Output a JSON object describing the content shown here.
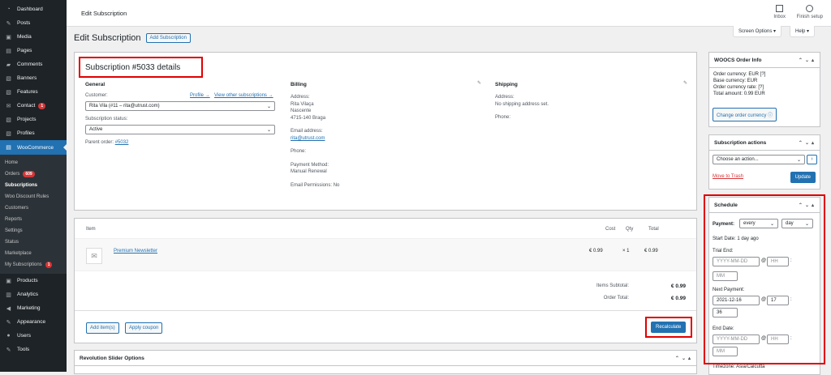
{
  "sidebar": {
    "items": [
      {
        "name": "dashboard",
        "label": "Dashboard",
        "icon": "◔"
      },
      {
        "name": "posts",
        "label": "Posts",
        "icon": "✎"
      },
      {
        "name": "media",
        "label": "Media",
        "icon": "▣"
      },
      {
        "name": "pages",
        "label": "Pages",
        "icon": "▤"
      },
      {
        "name": "comments",
        "label": "Comments",
        "icon": "▰"
      },
      {
        "name": "banners",
        "label": "Banners",
        "icon": "▧"
      },
      {
        "name": "features",
        "label": "Features",
        "icon": "▧"
      },
      {
        "name": "contact",
        "label": "Contact",
        "icon": "✉",
        "badge": "1"
      },
      {
        "name": "projects",
        "label": "Projects",
        "icon": "▧"
      },
      {
        "name": "profiles",
        "label": "Profiles",
        "icon": "▧"
      }
    ],
    "woo": {
      "label": "WooCommerce",
      "icon": "▤"
    },
    "sub": [
      {
        "label": "Home"
      },
      {
        "label": "Orders",
        "badge": "609"
      },
      {
        "label": "Subscriptions",
        "current": true
      },
      {
        "label": "Woo Discount Rules"
      },
      {
        "label": "Customers"
      },
      {
        "label": "Reports"
      },
      {
        "label": "Settings"
      },
      {
        "label": "Status"
      },
      {
        "label": "Marketplace"
      },
      {
        "label": "My Subscriptions",
        "badge": "1"
      }
    ],
    "items2": [
      {
        "name": "products",
        "label": "Products",
        "icon": "▣"
      },
      {
        "name": "analytics",
        "label": "Analytics",
        "icon": "▥"
      },
      {
        "name": "marketing",
        "label": "Marketing",
        "icon": "◀"
      },
      {
        "name": "appearance",
        "label": "Appearance",
        "icon": "✎"
      },
      {
        "name": "users",
        "label": "Users",
        "icon": "●"
      },
      {
        "name": "tools",
        "label": "Tools",
        "icon": "✎"
      }
    ]
  },
  "topbar": {
    "title": "Edit Subscription",
    "inbox": "Inbox",
    "finish": "Finish setup",
    "screen_options": "Screen Options ▾",
    "help": "Help ▾"
  },
  "head": {
    "title": "Edit Subscription",
    "add": "Add Subscription"
  },
  "details": {
    "title": "Subscription #5033 details",
    "general": {
      "heading": "General",
      "customer_label": "Customer:",
      "profile_link": "Profile →",
      "other_link": "View other subscriptions →",
      "customer_value": "Rita Vila (#11 – rita@utrust.com)",
      "status_label": "Subscription status:",
      "status_value": "Active",
      "parent_label": "Parent order:",
      "parent_link": "#5032"
    },
    "billing": {
      "heading": "Billing",
      "address_label": "Address:",
      "address_lines": [
        "Rita Vilaça",
        "Nascente",
        "4715-140 Braga"
      ],
      "email_label": "Email address:",
      "email": "rita@utrust.com",
      "phone_label": "Phone:",
      "payment_label": "Payment Method:",
      "payment_value": "Manual Renewal",
      "perm_label": "Email Permissions:",
      "perm_value": "No"
    },
    "shipping": {
      "heading": "Shipping",
      "address_label": "Address:",
      "address_value": "No shipping address set.",
      "phone_label": "Phone:"
    }
  },
  "items": {
    "col_item": "Item",
    "col_cost": "Cost",
    "col_qty": "Qty",
    "col_total": "Total",
    "row": {
      "name": "Premium Newsletter",
      "cost": "€ 0.99",
      "qty": "× 1",
      "total": "€ 0.99"
    },
    "subtotal_label": "Items Subtotal:",
    "subtotal": "€ 0.99",
    "order_total_label": "Order Total:",
    "order_total": "€ 0.99",
    "add_items": "Add item(s)",
    "apply_coupon": "Apply coupon",
    "recalculate": "Recalculate"
  },
  "slider": {
    "title": "Revolution Slider Options"
  },
  "woocs": {
    "title": "WOOCS Order Info",
    "lines": [
      "Order currency: EUR  [?]",
      "Base currency: EUR",
      "Order currency rate:   [?]",
      "Total amount: 0.99 EUR"
    ],
    "change": "Change order currency"
  },
  "actions": {
    "title": "Subscription actions",
    "choose": "Choose an action...",
    "trash": "Move to Trash",
    "update": "Update"
  },
  "schedule": {
    "title": "Schedule",
    "payment_label": "Payment:",
    "every": "every",
    "day": "day",
    "start": "Start Date: 1 day ago",
    "trial_label": "Trial End:",
    "date_ph": "YYYY-MM-DD",
    "hh_ph": "HH",
    "mm_ph": "MM",
    "next_label": "Next Payment:",
    "next_date": "2021-12-16",
    "next_hh": "17",
    "next_mm": "36",
    "end_label": "End Date:",
    "timezone": "Timezone: Asia/Calcutta"
  },
  "colors": {
    "sidebar": "#1d2327",
    "accent": "#2271b1",
    "highlight": "#e00000"
  }
}
